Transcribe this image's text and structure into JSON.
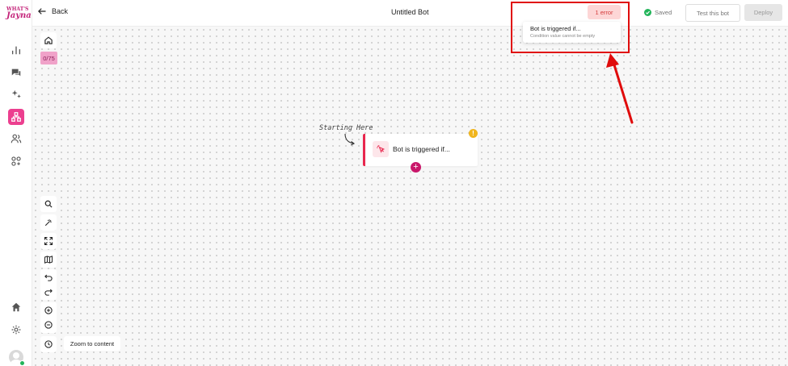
{
  "sidebar": {
    "logo_line1": "WHAT'S",
    "logo_line2": "Jayna",
    "items": [
      {
        "icon": "bar-chart-icon",
        "label": "Analytics"
      },
      {
        "icon": "chat-icon",
        "label": "Conversations"
      },
      {
        "icon": "sparkles-icon",
        "label": "AI"
      },
      {
        "icon": "flow-icon",
        "label": "Bot builder"
      },
      {
        "icon": "users-icon",
        "label": "Contacts"
      },
      {
        "icon": "integrations-icon",
        "label": "Integrations"
      },
      {
        "icon": "home-icon",
        "label": "Home"
      },
      {
        "icon": "gear-icon",
        "label": "Settings"
      }
    ]
  },
  "header": {
    "back_label": "Back",
    "title": "Untitled Bot",
    "error_badge": "1 error",
    "saved_label": "Saved",
    "test_button": "Test this bot",
    "deploy_button": "Deploy"
  },
  "error_popover": {
    "title": "Bot is triggered if...",
    "detail": "Condition value cannot be empty"
  },
  "canvas": {
    "counter": "0/75",
    "starting_label": "Starting Here",
    "node_label": "Bot is triggered if...",
    "warning_symbol": "!",
    "add_symbol": "+",
    "zoom_to_content_label": "Zoom to content"
  },
  "colors": {
    "brand_pink": "#ec3f8f",
    "error_red": "#e00c0c",
    "node_border": "#e8264d",
    "saved_green": "#22b45a",
    "warning_yellow": "#f0b51d"
  }
}
